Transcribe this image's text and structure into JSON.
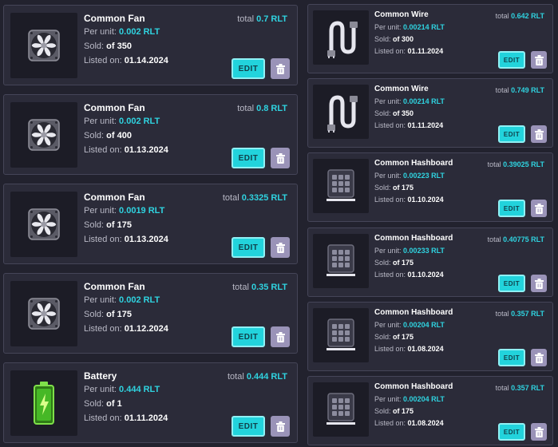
{
  "currency": "RLT",
  "labels": {
    "per_unit": "Per unit:",
    "sold": "Sold:",
    "listed_on": "Listed on:",
    "total": "total",
    "edit": "EDIT"
  },
  "colors": {
    "accent": "#2fd3e0",
    "card_bg": "#2b2b39",
    "border": "#454558",
    "trash_bg": "#9a93b8"
  },
  "left_listings": [
    {
      "name": "Common Fan",
      "icon": "fan-icon",
      "total": "0.7 RLT",
      "per_unit": "0.002 RLT",
      "sold": "of 350",
      "listed_on": "01.14.2024"
    },
    {
      "name": "Common Fan",
      "icon": "fan-icon",
      "total": "0.8 RLT",
      "per_unit": "0.002 RLT",
      "sold": "of 400",
      "listed_on": "01.13.2024"
    },
    {
      "name": "Common Fan",
      "icon": "fan-icon",
      "total": "0.3325 RLT",
      "per_unit": "0.0019 RLT",
      "sold": "of 175",
      "listed_on": "01.13.2024"
    },
    {
      "name": "Common Fan",
      "icon": "fan-icon",
      "total": "0.35 RLT",
      "per_unit": "0.002 RLT",
      "sold": "of 175",
      "listed_on": "01.12.2024"
    },
    {
      "name": "Battery",
      "icon": "battery-icon",
      "total": "0.444 RLT",
      "per_unit": "0.444 RLT",
      "sold": "of 1",
      "listed_on": "01.11.2024"
    }
  ],
  "right_listings": [
    {
      "name": "Common Wire",
      "icon": "wire-icon",
      "total": "0.642 RLT",
      "per_unit": "0.00214 RLT",
      "sold": "of 300",
      "listed_on": "01.11.2024"
    },
    {
      "name": "Common Wire",
      "icon": "wire-icon",
      "total": "0.749 RLT",
      "per_unit": "0.00214 RLT",
      "sold": "of 350",
      "listed_on": "01.11.2024"
    },
    {
      "name": "Common Hashboard",
      "icon": "hashboard-icon",
      "total": "0.39025 RLT",
      "per_unit": "0.00223 RLT",
      "sold": "of 175",
      "listed_on": "01.10.2024"
    },
    {
      "name": "Common Hashboard",
      "icon": "hashboard-icon",
      "total": "0.40775 RLT",
      "per_unit": "0.00233 RLT",
      "sold": "of 175",
      "listed_on": "01.10.2024"
    },
    {
      "name": "Common Hashboard",
      "icon": "hashboard-icon",
      "total": "0.357 RLT",
      "per_unit": "0.00204 RLT",
      "sold": "of 175",
      "listed_on": "01.08.2024"
    },
    {
      "name": "Common Hashboard",
      "icon": "hashboard-icon",
      "total": "0.357 RLT",
      "per_unit": "0.00204 RLT",
      "sold": "of 175",
      "listed_on": "01.08.2024"
    }
  ]
}
